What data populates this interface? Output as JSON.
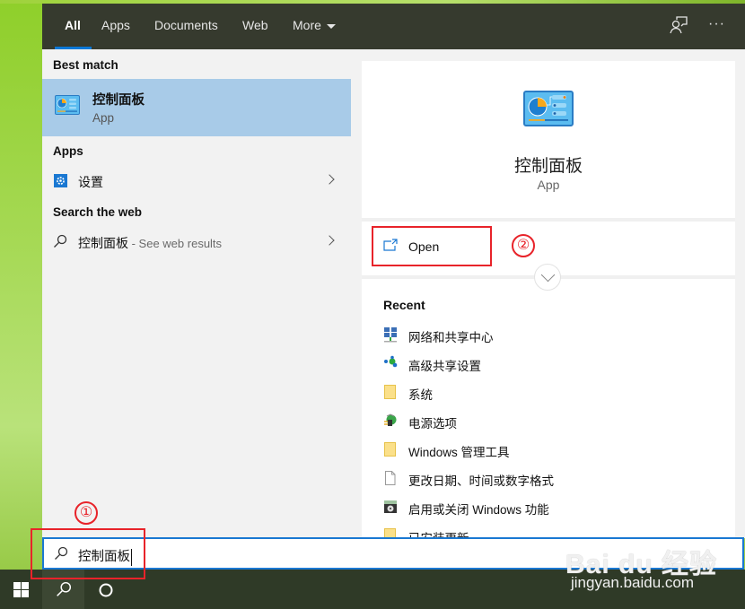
{
  "header": {
    "tabs": [
      {
        "label": "All",
        "active": true
      },
      {
        "label": "Apps",
        "active": false
      },
      {
        "label": "Documents",
        "active": false
      },
      {
        "label": "Web",
        "active": false
      },
      {
        "label": "More",
        "active": false
      }
    ],
    "feedback_icon": "feedback-person-icon",
    "more_options_label": "···"
  },
  "left": {
    "best_match_heading": "Best match",
    "best_match": {
      "title": "控制面板",
      "subtitle": "App",
      "icon": "control-panel-icon"
    },
    "apps_heading": "Apps",
    "apps": [
      {
        "label": "设置",
        "icon": "settings-gear-icon"
      }
    ],
    "web_heading": "Search the web",
    "web_results": [
      {
        "label": "控制面板",
        "suffix": " - See web results",
        "icon": "search-icon"
      }
    ]
  },
  "right": {
    "app_title": "控制面板",
    "app_subtitle": "App",
    "open_label": "Open",
    "recent_heading": "Recent",
    "recent": [
      {
        "label": "网络和共享中心",
        "icon": "network-icon"
      },
      {
        "label": "高级共享设置",
        "icon": "sharing-icon"
      },
      {
        "label": "系统",
        "icon": "folder-icon"
      },
      {
        "label": "电源选项",
        "icon": "power-plug-icon"
      },
      {
        "label": "Windows 管理工具",
        "icon": "folder-icon"
      },
      {
        "label": "更改日期、时间或数字格式",
        "icon": "document-icon"
      },
      {
        "label": "启用或关闭 Windows 功能",
        "icon": "windows-features-icon"
      },
      {
        "label": "已安装更新",
        "icon": "folder-icon"
      }
    ]
  },
  "search": {
    "query": "控制面板"
  },
  "annotations": {
    "step1": "①",
    "step2": "②"
  },
  "watermark": {
    "brand": "Bai du 经验",
    "url": "jingyan.baidu.com"
  },
  "colors": {
    "accent": "#0a78d7",
    "annotation": "#e8232a",
    "selection": "#a8cbe8"
  }
}
